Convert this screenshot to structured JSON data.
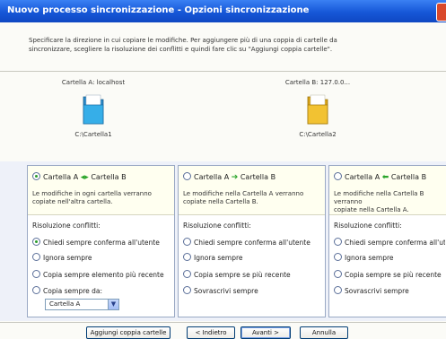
{
  "window": {
    "title": "Nuovo processo sincronizzazione - Opzioni sincronizzazione"
  },
  "description": "Specificare la direzione in cui copiare le modifiche. Per aggiungere più di una coppia di cartelle da\nsincronizzare, scegliere la risoluzione dei conflitti e quindi fare clic su \"Aggiungi coppia cartelle\".",
  "folder_a": {
    "label": "Cartella A: localhost",
    "path": "C:\\Cartella1",
    "icon": "folder-blue-icon",
    "color": "#2f9fd8"
  },
  "folder_b": {
    "label": "Cartella B: 127.0.0...",
    "path": "C:\\Cartella2",
    "icon": "folder-yellow-icon",
    "color": "#e8b420"
  },
  "panels": [
    {
      "title_left": "Cartella A",
      "title_right": "Cartella B",
      "arrow": "◆",
      "selected": true,
      "text": "Le modifiche in ogni cartella verranno\ncopiate nell'altra cartella.",
      "conflict_label": "Risoluzione conflitti:",
      "options": [
        "Chiedi sempre conferma all'utente",
        "Ignora sempre",
        "Copia sempre elemento più recente",
        "Copia sempre da:"
      ],
      "selected_option": 0,
      "dropdown_value": "Cartella A"
    },
    {
      "title_left": "Cartella A",
      "title_right": "Cartella B",
      "arrow": "➔",
      "selected": false,
      "text": "Le modifiche nella Cartella A verranno\ncopiate nella Cartella B.",
      "conflict_label": "Risoluzione conflitti:",
      "options": [
        "Chiedi sempre conferma all'utente",
        "Ignora sempre",
        "Copia sempre se più recente",
        "Sovrascrivi sempre"
      ],
      "selected_option": -1
    },
    {
      "title_left": "Cartella A",
      "title_right": "Cartella B",
      "arrow": "⬅",
      "selected": false,
      "text": "Le modifiche nella Cartella B verranno\ncopiate nella Cartella A.",
      "conflict_label": "Risoluzione conflitti:",
      "options": [
        "Chiedi sempre conferma all'utente",
        "Ignora sempre",
        "Copia sempre se più recente",
        "Sovrascrivi sempre"
      ],
      "selected_option": -1
    }
  ],
  "buttons": {
    "add_pair": "Aggiungi coppia cartelle",
    "back": "< Indietro",
    "next": "Avanti >",
    "cancel": "Annulla"
  },
  "colors": {
    "titlebar": "#1657d8",
    "selected_radio": "#2a9c2a",
    "panel_header": "#fffff0"
  }
}
